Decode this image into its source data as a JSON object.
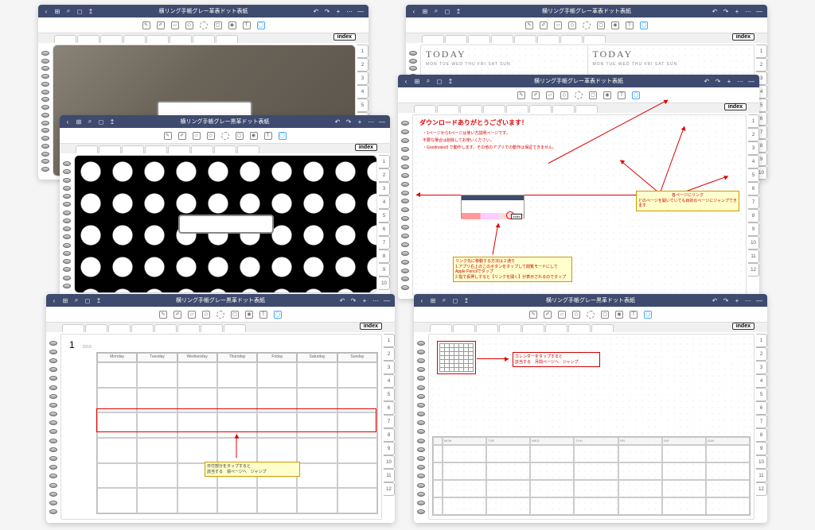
{
  "app_title_gray": "横リング手帳グレー革表ドット表紙",
  "app_title_black": "横リング手帳グレー黒革ドット表紙",
  "index_label": "index",
  "side_tabs": [
    "1",
    "2",
    "3",
    "4",
    "5",
    "6",
    "7",
    "8",
    "9",
    "10",
    "11",
    "12"
  ],
  "weekdays_en": [
    "Monday",
    "Tuesday",
    "Wednesday",
    "Thursday",
    "Friday",
    "Saturday",
    "Sunday"
  ],
  "weekdays_short": [
    "MON",
    "TUE",
    "WED",
    "THU",
    "FRI",
    "SAT",
    "SUN"
  ],
  "today_label": "TODAY",
  "dow_string": "MON TUE WED THU FRI SAT SUN",
  "instr": {
    "thanks": "ダウンロードありがとうございます！",
    "line1": "・1ページから6ページは使い方説明ページです。",
    "line2": "  不要な場合は削除してお使いください。",
    "line3": "・Goodnotes5 で動作します。その他のアプリでの動作は保証できません。",
    "note1_title": "各ページにリンク",
    "note1_body": "どのページを開いていても目的のページにジャンプできます",
    "note2_title": "リンク先に移動する方法は２通り",
    "note2_l1": "1.アプリ右上のこのボタンをタップして閲覧モードにして",
    "note2_l2": "  Apple Pencilでタップ",
    "note2_l3": "2.指で長押しすると【リンクを開く】が表示されるのでタップ"
  },
  "month": {
    "num": "1",
    "year": "2019",
    "note_title": "日付部分をタップすると",
    "note_body": "該当する　週ページへ　ジャンプ"
  },
  "week_note": {
    "l1": "カレンダーをタップすると",
    "l2": "該当する　月間ページへ　ジャンプ"
  }
}
